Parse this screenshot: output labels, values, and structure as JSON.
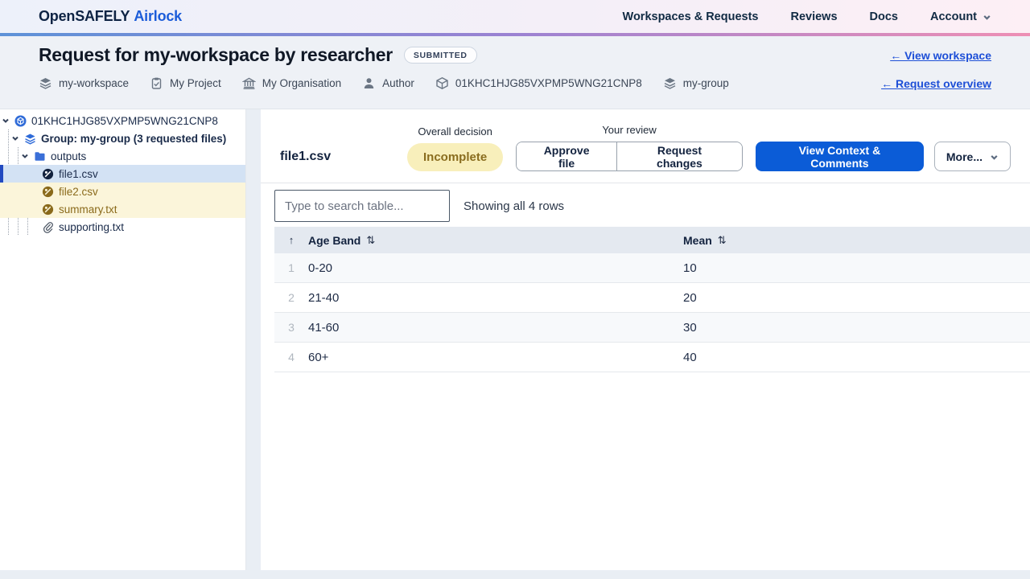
{
  "nav": {
    "brand_primary": "OpenSAFELY",
    "brand_secondary": "Airlock",
    "items": [
      {
        "label": "Workspaces & Requests"
      },
      {
        "label": "Reviews"
      },
      {
        "label": "Docs"
      }
    ],
    "account_label": "Account"
  },
  "header": {
    "title": "Request for my-workspace by researcher",
    "status_badge": "SUBMITTED",
    "view_workspace_link": "← View workspace",
    "request_overview_link": "← Request overview",
    "meta": [
      {
        "icon": "layers-icon",
        "label": "my-workspace"
      },
      {
        "icon": "clipboard-icon",
        "label": "My Project"
      },
      {
        "icon": "building-icon",
        "label": "My Organisation"
      },
      {
        "icon": "user-icon",
        "label": "Author"
      },
      {
        "icon": "cube-icon",
        "label": "01KHC1HJG85VXPMP5WNG21CNP8"
      },
      {
        "icon": "layers-icon",
        "label": "my-group"
      }
    ]
  },
  "sidebar": {
    "tree": [
      {
        "label": "01KHC1HJG85VXPMP5WNG21CNP8",
        "icon": "request-cube-icon",
        "expanded": true
      },
      {
        "label": "Group: my-group (3 requested files)",
        "icon": "group-layers-icon",
        "expanded": true
      },
      {
        "label": "outputs",
        "icon": "folder-icon",
        "expanded": true
      },
      {
        "label": "file1.csv",
        "icon": "file-pending-icon",
        "state": "selected"
      },
      {
        "label": "file2.csv",
        "icon": "file-pending-icon",
        "state": "changes-requested"
      },
      {
        "label": "summary.txt",
        "icon": "file-pending-icon",
        "state": "changes-requested"
      },
      {
        "label": "supporting.txt",
        "icon": "paperclip-icon",
        "state": "supporting"
      }
    ]
  },
  "main": {
    "file_title": "file1.csv",
    "overall_decision_label": "Overall decision",
    "decision_badge": "Incomplete",
    "your_review_label": "Your review",
    "approve_label": "Approve file",
    "request_changes_label": "Request changes",
    "context_button_label": "View Context & Comments",
    "more_label": "More...",
    "search_placeholder": "Type to search table...",
    "rows_status": "Showing all 4 rows",
    "table": {
      "primary_sort_glyph": "↑",
      "sort_glyph": "⇅",
      "columns": [
        "Age Band",
        "Mean"
      ],
      "rows": [
        {
          "n": "1",
          "age_band": "0-20",
          "mean": "10"
        },
        {
          "n": "2",
          "age_band": "21-40",
          "mean": "20"
        },
        {
          "n": "3",
          "age_band": "41-60",
          "mean": "30"
        },
        {
          "n": "4",
          "age_band": "60+",
          "mean": "40"
        }
      ]
    }
  },
  "colors": {
    "accent_blue": "#0b5cd7",
    "link_blue": "#1d4fd7",
    "incomplete_bg": "#f8efbb",
    "incomplete_text": "#8a6d1f",
    "changes_row_bg": "#fbf5da",
    "selected_row_bg": "#d3e2f4",
    "selected_bar": "#2149c0",
    "nav_gradient": [
      "#5d92d8",
      "#9b82d2",
      "#ee8fb4"
    ]
  }
}
